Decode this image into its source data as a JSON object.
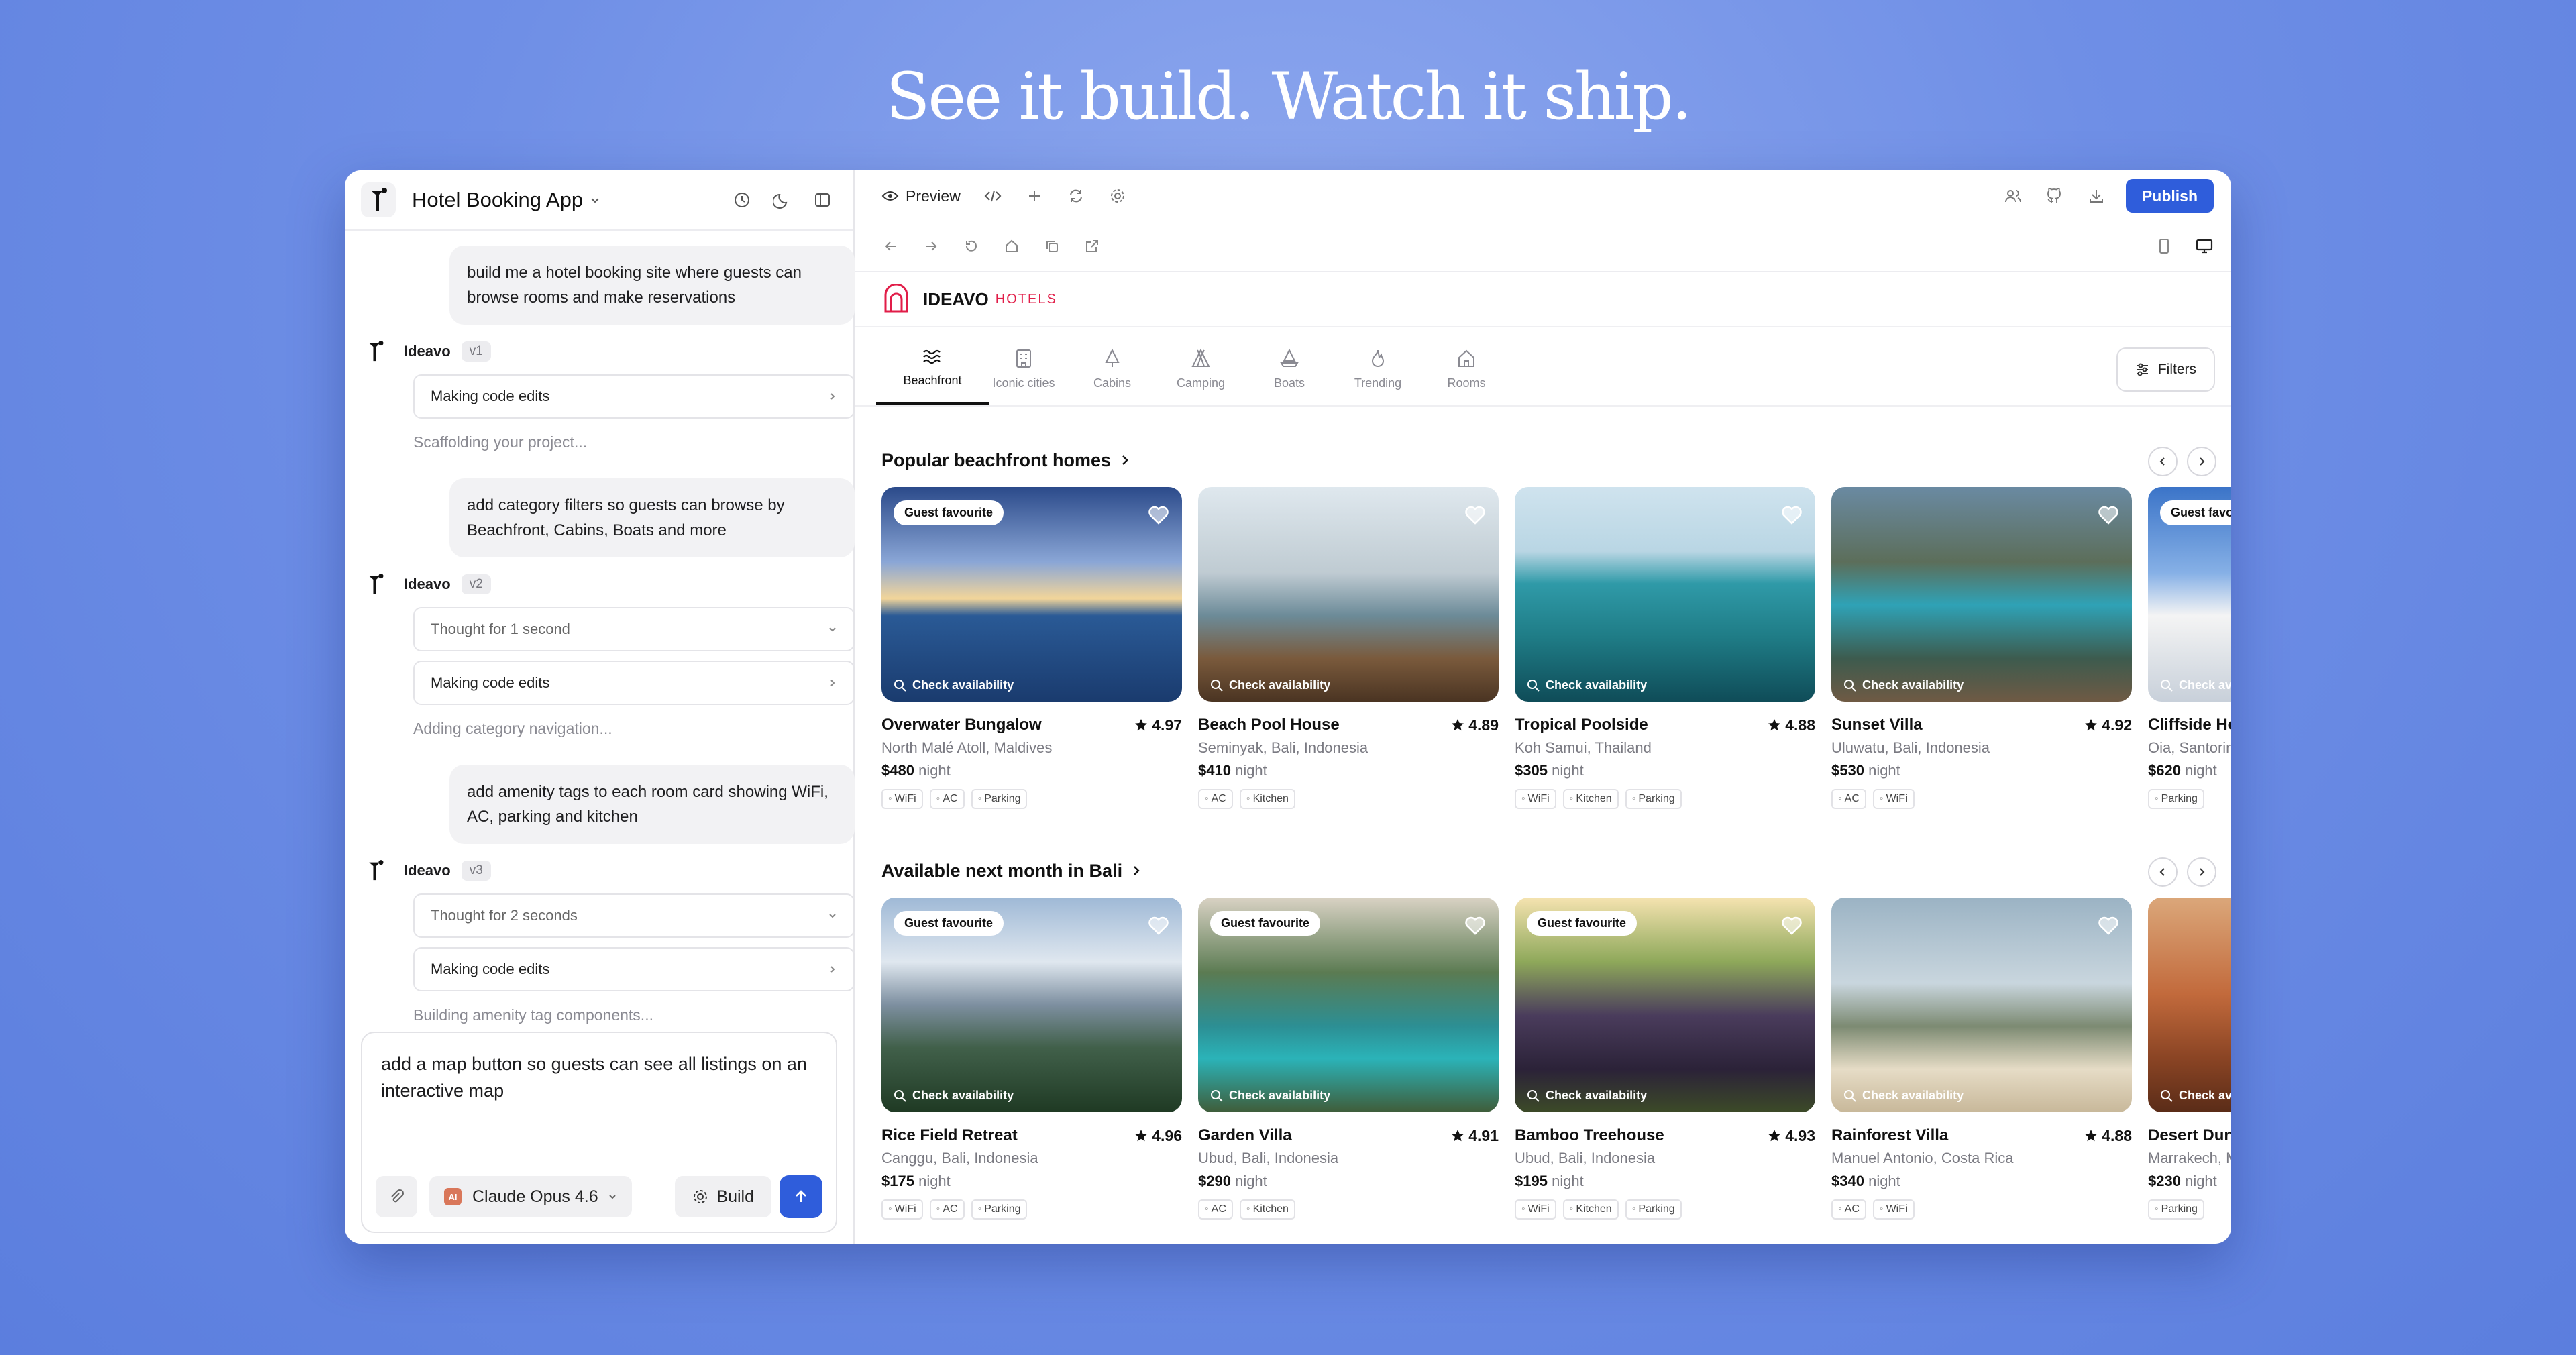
{
  "headline": "See it build. Watch it ship.",
  "chat": {
    "app_title": "Hotel Booking App",
    "bot_name": "Ideavo",
    "messages": [
      {
        "user": "build me a hotel booking site where guests can browse rooms and make reservations",
        "version": "v1",
        "thought": null,
        "step": "Making code edits",
        "status": "Scaffolding your project..."
      },
      {
        "user": "add category filters so guests can browse by Beachfront, Cabins, Boats and more",
        "version": "v2",
        "thought": "Thought for 1 second",
        "step": "Making code edits",
        "status": "Adding category navigation..."
      },
      {
        "user": "add amenity tags to each room card showing WiFi, AC, parking and kitchen",
        "version": "v3",
        "thought": "Thought for 2 seconds",
        "step": "Making code edits",
        "status": "Building amenity tag components..."
      }
    ],
    "composer": {
      "text": "add a map button so guests can see all listings on an interactive map",
      "model": "Claude Opus 4.6",
      "build_label": "Build"
    }
  },
  "preview": {
    "tab_label": "Preview",
    "publish_label": "Publish",
    "brand": {
      "name": "IDEAVO",
      "sub": "HOTELS",
      "accent": "#e11d48"
    },
    "categories": [
      "Beachfront",
      "Iconic cities",
      "Cabins",
      "Camping",
      "Boats",
      "Trending",
      "Rooms"
    ],
    "active_category": "Beachfront",
    "filters_label": "Filters",
    "sections": [
      {
        "title": "Popular beachfront homes",
        "cards": [
          {
            "name": "Overwater Bungalow",
            "rating": "4.97",
            "location": "North Malé Atoll, Maldives",
            "price": "$480",
            "unit": "night",
            "badge": "Guest favourite",
            "tags": [
              "WiFi",
              "AC",
              "Parking"
            ]
          },
          {
            "name": "Beach Pool House",
            "rating": "4.89",
            "location": "Seminyak, Bali, Indonesia",
            "price": "$410",
            "unit": "night",
            "badge": "",
            "tags": [
              "AC",
              "Kitchen"
            ]
          },
          {
            "name": "Tropical Poolside",
            "rating": "4.88",
            "location": "Koh Samui, Thailand",
            "price": "$305",
            "unit": "night",
            "badge": "",
            "tags": [
              "WiFi",
              "Kitchen",
              "Parking"
            ]
          },
          {
            "name": "Sunset Villa",
            "rating": "4.92",
            "location": "Uluwatu, Bali, Indonesia",
            "price": "$530",
            "unit": "night",
            "badge": "",
            "tags": [
              "AC",
              "WiFi"
            ]
          },
          {
            "name": "Cliffside Ho",
            "rating": "",
            "location": "Oia, Santorin",
            "price": "$620",
            "unit": "night",
            "badge": "Guest favo",
            "tags": [
              "Parking"
            ]
          }
        ]
      },
      {
        "title": "Available next month in Bali",
        "cards": [
          {
            "name": "Rice Field Retreat",
            "rating": "4.96",
            "location": "Canggu, Bali, Indonesia",
            "price": "$175",
            "unit": "night",
            "badge": "Guest favourite",
            "tags": [
              "WiFi",
              "AC",
              "Parking"
            ]
          },
          {
            "name": "Garden Villa",
            "rating": "4.91",
            "location": "Ubud, Bali, Indonesia",
            "price": "$290",
            "unit": "night",
            "badge": "Guest favourite",
            "tags": [
              "AC",
              "Kitchen"
            ]
          },
          {
            "name": "Bamboo Treehouse",
            "rating": "4.93",
            "location": "Ubud, Bali, Indonesia",
            "price": "$195",
            "unit": "night",
            "badge": "Guest favourite",
            "tags": [
              "WiFi",
              "Kitchen",
              "Parking"
            ]
          },
          {
            "name": "Rainforest Villa",
            "rating": "4.88",
            "location": "Manuel Antonio, Costa Rica",
            "price": "$340",
            "unit": "night",
            "badge": "",
            "tags": [
              "AC",
              "WiFi"
            ]
          },
          {
            "name": "Desert Dun",
            "rating": "",
            "location": "Marrakech, M",
            "price": "$230",
            "unit": "night",
            "badge": "",
            "tags": [
              "Parking"
            ]
          }
        ]
      }
    ],
    "check_label": "Check availability"
  }
}
